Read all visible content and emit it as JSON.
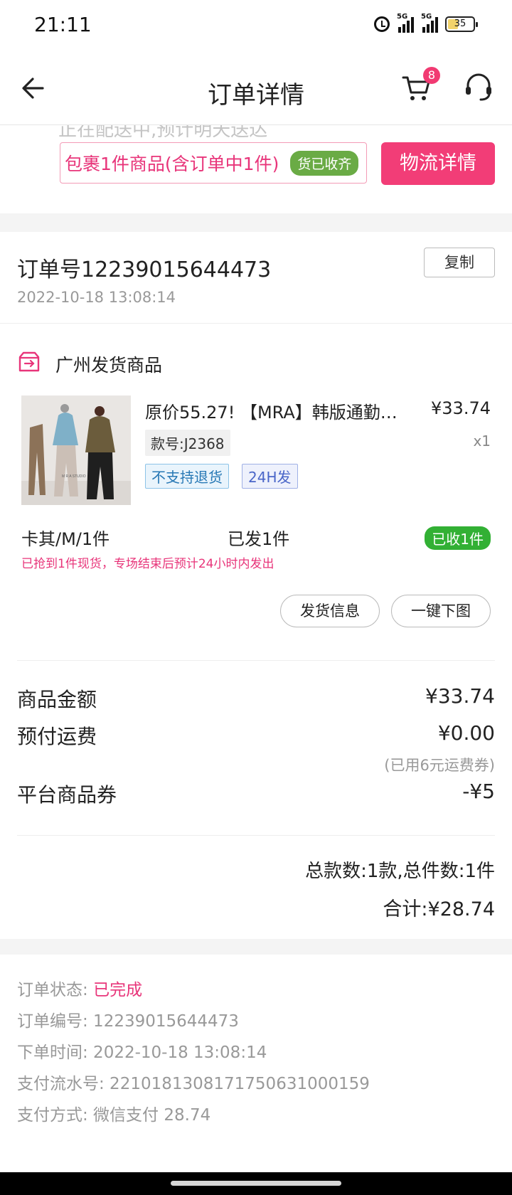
{
  "status_bar": {
    "time": "21:11",
    "signal1_label": "5G",
    "signal2_label": "5G",
    "battery": "35"
  },
  "nav": {
    "title": "订单详情",
    "cart_count": "8"
  },
  "package": {
    "ghost_text": "正在配送中,预计明天送达",
    "summary": "包裹1件商品(含订单中1件)",
    "badge": "货已收齐",
    "logistics_button": "物流详情"
  },
  "order": {
    "number_line": "订单号12239015644473",
    "copy_button": "复制",
    "date": "2022-10-18 13:08:14",
    "shipping_origin": "广州发货商品"
  },
  "product": {
    "title": "原价55.27! 【MRA】韩版通勤…",
    "price": "¥33.74",
    "sku": "款号:J2368",
    "qty": "x1",
    "tags": [
      "不支持退货",
      "24H发"
    ],
    "variant": "卡其/M/1件",
    "shipped": "已发1件",
    "received": "已收1件",
    "stock_note": "已抢到1件现货，专场结束后预计24小时内发出",
    "buttons": [
      "发货信息",
      "一键下图"
    ]
  },
  "amounts": {
    "goods_label": "商品金额",
    "goods_value": "¥33.74",
    "shipping_label": "预付运费",
    "shipping_value": "¥0.00",
    "shipping_note": "(已用6元运费券)",
    "coupon_label": "平台商品券",
    "coupon_value": "-¥5",
    "count_summary": "总款数:1款,总件数:1件",
    "total": "合计:¥28.74"
  },
  "info": {
    "status_label": "订单状态:",
    "status_value": "已完成",
    "order_no": "订单编号:  12239015644473",
    "order_time": "下单时间:  2022-10-18 13:08:14",
    "serial": "支付流水号:  221018130817175063100015９",
    "payment": "支付方式: 微信支付 28.74"
  },
  "colors": {
    "accent": "#f23d77",
    "green": "#32b034",
    "muted": "#999999"
  }
}
